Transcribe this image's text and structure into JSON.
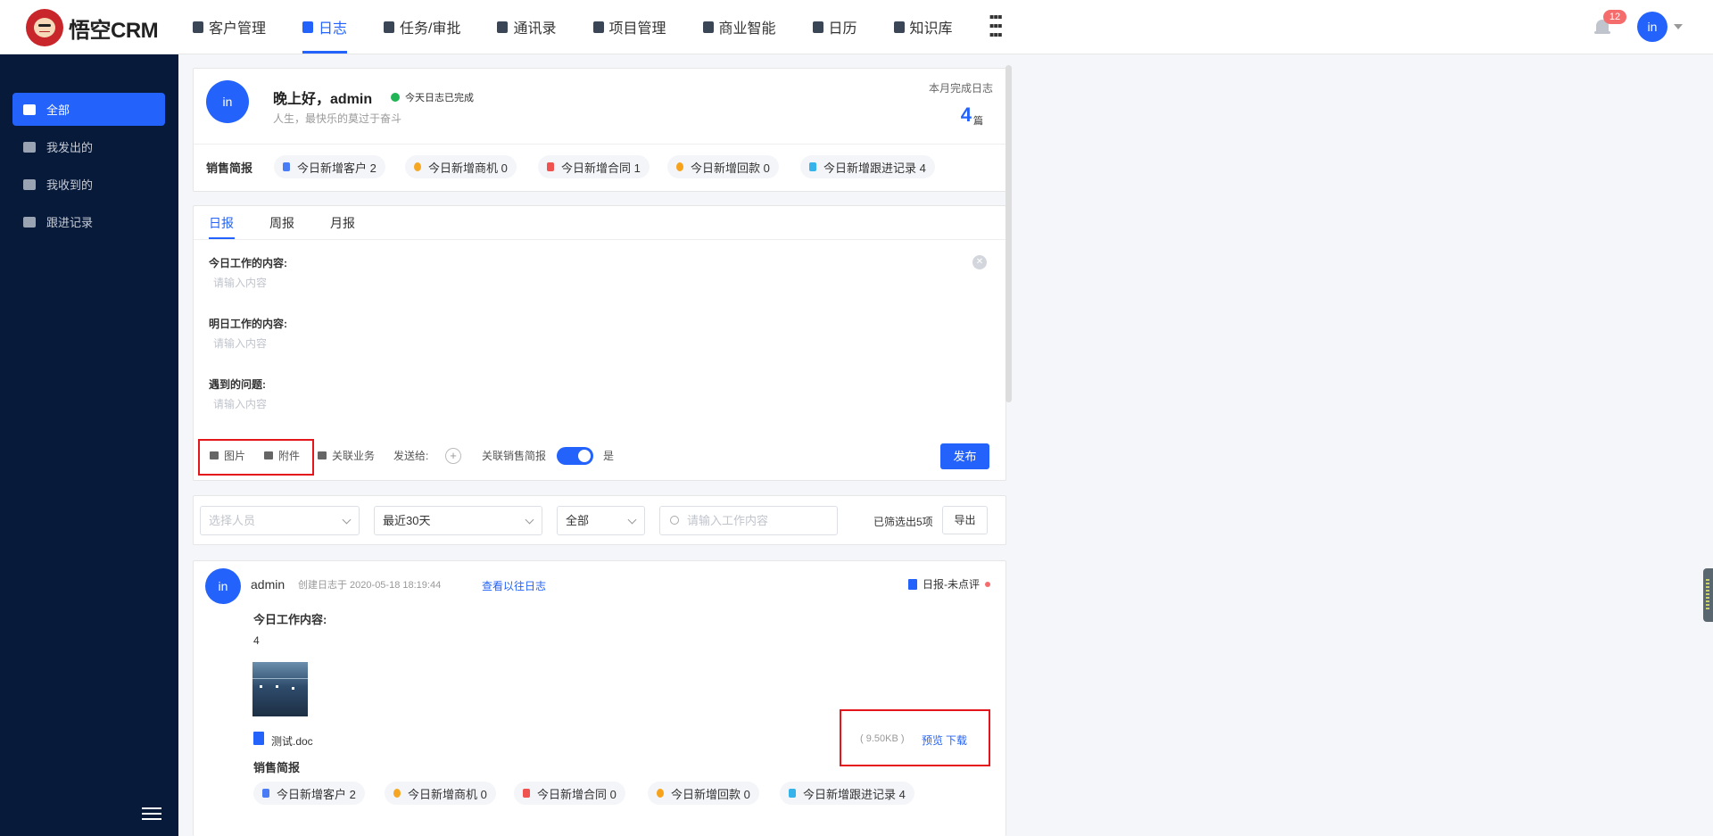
{
  "app": {
    "logo_text": "悟空CRM"
  },
  "nav": {
    "items": [
      "客户管理",
      "日志",
      "任务/审批",
      "通讯录",
      "项目管理",
      "商业智能",
      "日历",
      "知识库"
    ],
    "apps_icon": "grid-icon"
  },
  "header": {
    "notification_count": "12",
    "avatar_text": "in"
  },
  "sidebar": {
    "items": [
      "全部",
      "我发出的",
      "我收到的",
      "跟进记录"
    ],
    "icons": [
      "grid-icon",
      "send-icon",
      "mail-icon",
      "chat-icon"
    ]
  },
  "greeting": {
    "avatar_text": "in",
    "title": "晚上好，admin",
    "status": "今天日志已完成",
    "motto": "人生，最快乐的莫过于奋斗",
    "month_label": "本月完成日志",
    "month_count": "4",
    "month_unit": "篇"
  },
  "sales_brief": {
    "label": "销售简报",
    "chips": [
      "今日新增客户 2",
      "今日新增商机 0",
      "今日新增合同 1",
      "今日新增回款 0",
      "今日新增跟进记录 4"
    ]
  },
  "composer": {
    "tabs": [
      "日报",
      "周报",
      "月报"
    ],
    "fields": [
      {
        "label": "今日工作的内容:",
        "placeholder": "请输入内容"
      },
      {
        "label": "明日工作的内容:",
        "placeholder": "请输入内容"
      },
      {
        "label": "遇到的问题:",
        "placeholder": "请输入内容"
      }
    ],
    "tools": {
      "image": "图片",
      "attachment": "附件",
      "related": "关联业务",
      "send_to": "发送给:",
      "link_sales": "关联销售简报",
      "switch_value": "是"
    },
    "publish": "发布"
  },
  "filters": {
    "person_placeholder": "选择人员",
    "range": "最近30天",
    "type": "全部",
    "search_placeholder": "请输入工作内容",
    "result": "已筛选出5项",
    "export": "导出"
  },
  "log_entry": {
    "avatar_text": "in",
    "author": "admin",
    "created": "创建日志于 2020-05-18 18:19:44",
    "view_history": "查看以往日志",
    "status": "日报-未点评",
    "today_label": "今日工作内容:",
    "today_value": "4",
    "file_name": "测试.doc",
    "file_size": "( 9.50KB )",
    "preview": "预览",
    "download": "下载",
    "sales_label": "销售简报",
    "chips": [
      "今日新增客户 2",
      "今日新增商机 0",
      "今日新增合同 0",
      "今日新增回款 0",
      "今日新增跟进记录 4"
    ]
  },
  "colors": {
    "accent": "#2362fb",
    "sidebar_bg": "#071a3a",
    "highlight_box": "#e4161c"
  }
}
